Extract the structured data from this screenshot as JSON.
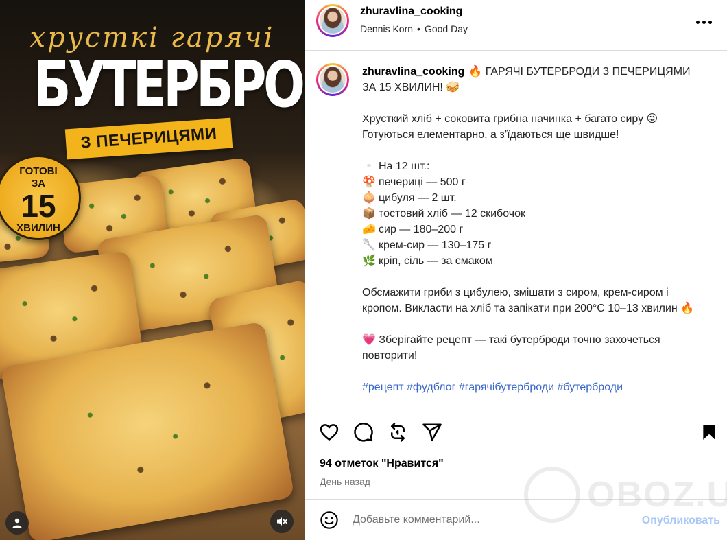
{
  "media": {
    "subtitle": "хрусткі гарячі",
    "title": "БУТЕРБРОДИ",
    "ribbon": "З ПЕЧЕРИЦЯМИ",
    "badge": {
      "line1": "ГОТОВІ",
      "line2": "ЗА",
      "number": "15",
      "line3": "ХВИЛИН"
    }
  },
  "header": {
    "username": "zhuravlina_cooking",
    "audio_artist": "Dennis Korn",
    "separator": "•",
    "audio_track": "Good Day"
  },
  "caption": {
    "username": "zhuravlina_cooking",
    "headline": "🔥 ГАРЯЧІ БУТЕРБРОДИ З ПЕЧЕРИЦЯМИ ЗА 15 ХВИЛИН! 🥪",
    "intro_line1": "Хрусткий хліб + соковита грибна начинка + багато сиру 😜",
    "intro_line2": "Готуються елементарно, а з’їдаються ще швидше!",
    "ingredients": [
      {
        "emoji": "▫️",
        "text": "На 12 шт.:"
      },
      {
        "emoji": "🍄",
        "text": "печериці — 500 г"
      },
      {
        "emoji": "🧅",
        "text": "цибуля — 2 шт."
      },
      {
        "emoji": "📦",
        "text": "тостовий хліб — 12 скибочок"
      },
      {
        "emoji": "🧀",
        "text": "сир — 180–200 г"
      },
      {
        "emoji": "🥄",
        "text": "крем-сир — 130–175 г"
      },
      {
        "emoji": "🌿",
        "text": "кріп, сіль — за смаком"
      }
    ],
    "method": "Обсмажити гриби з цибулею, змішати з сиром, крем-сиром і кропом. Викласти на хліб та запікати при 200°С 10–13 хвилин 🔥",
    "outro": "💗 Зберігайте рецепт — такі бутерброди точно захочеться повторити!",
    "hashtags": "#рецепт #фудблог #гарячібутерброди #бутерброди"
  },
  "stats": {
    "likes": "94 отметок \"Нравится\"",
    "time": "День назад"
  },
  "comment": {
    "placeholder": "Добавьте комментарий...",
    "publish": "Опубликовать"
  },
  "watermark": {
    "text": "OBOZ.UA"
  }
}
